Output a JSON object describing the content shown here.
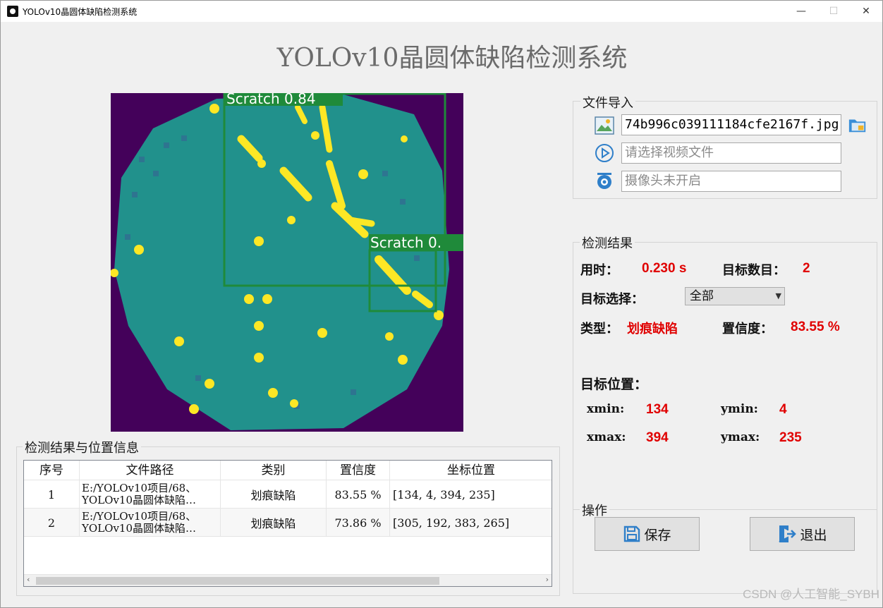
{
  "window": {
    "title": "YOLOv10晶圆体缺陷检测系统",
    "minimize": "—",
    "maximize": "☐",
    "close": "✕"
  },
  "app_title": "YOLOv10晶圆体缺陷检测系统",
  "image_view": {
    "detections": [
      {
        "label": "Scratch 0.84"
      },
      {
        "label": "Scratch 0."
      }
    ]
  },
  "file_import": {
    "title": "文件导入",
    "image_value": "74b996c039111184cfe2167f.jpg",
    "video_placeholder": "请选择视频文件",
    "camera_placeholder": "摄像头未开启"
  },
  "results": {
    "title": "检测结果",
    "time_label": "用时：",
    "time_value": "0.230 s",
    "count_label": "目标数目：",
    "count_value": "2",
    "select_label": "目标选择：",
    "select_value": "全部",
    "type_label": "类型：",
    "type_value": "划痕缺陷",
    "conf_label": "置信度：",
    "conf_value": "83.55 %",
    "pos_label": "目标位置：",
    "xmin_label": "xmin:",
    "xmin_value": "134",
    "ymin_label": "ymin:",
    "ymin_value": "4",
    "xmax_label": "xmax:",
    "xmax_value": "394",
    "ymax_label": "ymax:",
    "ymax_value": "235"
  },
  "operations": {
    "title": "操作",
    "save": "保存",
    "exit": "退出"
  },
  "table": {
    "title": "检测结果与位置信息",
    "headers": [
      "序号",
      "文件路径",
      "类别",
      "置信度",
      "坐标位置"
    ],
    "rows": [
      {
        "index": "1",
        "path1": "E:/YOLOv10项目/68、",
        "path2": "YOLOv10晶圆体缺陷…",
        "cls": "划痕缺陷",
        "conf": "83.55 %",
        "coords": "[134, 4, 394, 235]"
      },
      {
        "index": "2",
        "path1": "E:/YOLOv10项目/68、",
        "path2": "YOLOv10晶圆体缺陷…",
        "cls": "划痕缺陷",
        "conf": "73.86 %",
        "coords": "[305, 192, 383, 265]"
      }
    ]
  },
  "watermark": "CSDN @人工智能_SYBH",
  "colors": {
    "wafer_bg": "#44015a",
    "wafer_body": "#21918c",
    "defect": "#fde725",
    "box": "#1f8a3a",
    "value_red": "#e00000"
  }
}
